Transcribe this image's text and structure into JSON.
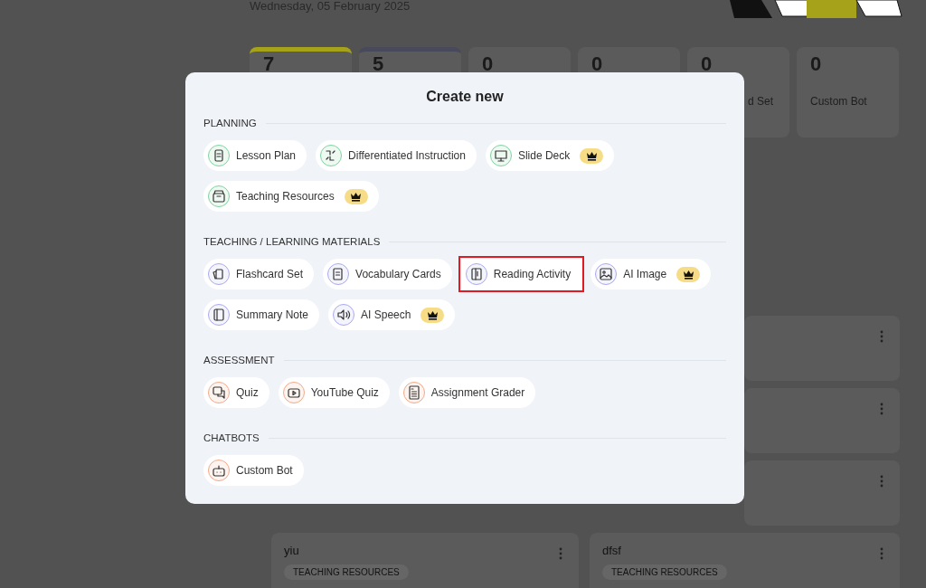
{
  "dashboard": {
    "date": "Wednesday, 05 February 2025",
    "stats": [
      {
        "value": "7",
        "color": "#a6a21a"
      },
      {
        "value": "5",
        "color": "#484a5c"
      },
      {
        "value": "0"
      },
      {
        "value": "0"
      },
      {
        "value": "0",
        "label": "d Set",
        "partial": true
      },
      {
        "value": "0",
        "label": "Custom Bot"
      }
    ],
    "cards": [
      {
        "kind": "covered"
      },
      {
        "kind": "covered"
      },
      {
        "kind": "covered"
      },
      {
        "kind": "full",
        "title": "yiu",
        "tag": "TEACHING RESOURCES"
      },
      {
        "kind": "full",
        "title": "dfsf",
        "tag": "TEACHING RESOURCES"
      }
    ]
  },
  "modal": {
    "title": "Create new",
    "sections": [
      {
        "heading": "PLANNING",
        "color": "#7fd3a0",
        "items": [
          {
            "label": "Lesson Plan",
            "premium": false,
            "highlighted": false
          },
          {
            "label": "Differentiated Instruction",
            "premium": false,
            "highlighted": false
          },
          {
            "label": "Slide Deck",
            "premium": true,
            "highlighted": false
          },
          {
            "label": "Teaching Resources",
            "premium": true,
            "highlighted": false
          }
        ]
      },
      {
        "heading": "TEACHING / LEARNING MATERIALS",
        "color": "#a9a9f0",
        "items": [
          {
            "label": "Flashcard Set",
            "premium": false,
            "highlighted": false
          },
          {
            "label": "Vocabulary Cards",
            "premium": false,
            "highlighted": false
          },
          {
            "label": "Reading Activity",
            "premium": false,
            "highlighted": true
          },
          {
            "label": "AI Image",
            "premium": true,
            "highlighted": false
          },
          {
            "label": "Summary Note",
            "premium": false,
            "highlighted": false
          },
          {
            "label": "AI Speech",
            "premium": true,
            "highlighted": false
          }
        ]
      },
      {
        "heading": "ASSESSMENT",
        "color": "#f2a98a",
        "items": [
          {
            "label": "Quiz",
            "premium": false,
            "highlighted": false
          },
          {
            "label": "YouTube Quiz",
            "premium": false,
            "highlighted": false
          },
          {
            "label": "Assignment Grader",
            "premium": false,
            "highlighted": false
          }
        ]
      },
      {
        "heading": "CHATBOTS",
        "color": "#f2a98a",
        "items": [
          {
            "label": "Custom Bot",
            "premium": false,
            "highlighted": false
          }
        ]
      }
    ]
  }
}
